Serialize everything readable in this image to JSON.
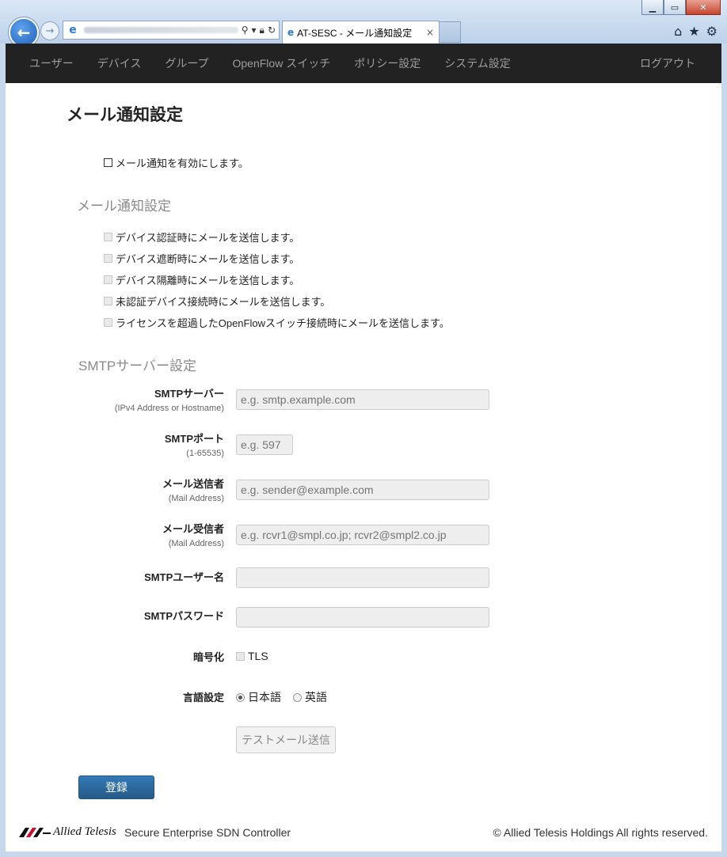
{
  "browser": {
    "tab_title": "AT-SESC - メール通知設定",
    "tab_close": "×",
    "window_buttons": [
      "minimize-icon",
      "maximize-icon",
      "close-icon"
    ],
    "toolbar_icons": [
      "home-icon",
      "star-icon",
      "gear-icon"
    ]
  },
  "nav": {
    "items": [
      "ユーザー",
      "デバイス",
      "グループ",
      "OpenFlow スイッチ",
      "ポリシー設定",
      "システム設定"
    ],
    "logout": "ログアウト"
  },
  "page": {
    "title": "メール通知設定",
    "enable_label": "メール通知を有効にします。"
  },
  "notify_section": {
    "title": "メール通知設定",
    "options": [
      "デバイス認証時にメールを送信します。",
      "デバイス遮断時にメールを送信します。",
      "デバイス隔離時にメールを送信します。",
      "未認証デバイス接続時にメールを送信します。",
      "ライセンスを超過したOpenFlowスイッチ接続時にメールを送信します。"
    ]
  },
  "smtp_section": {
    "title": "SMTPサーバー設定",
    "server": {
      "label": "SMTPサーバー",
      "sub": "(IPv4 Address or Hostname)",
      "placeholder": "e.g. smtp.example.com"
    },
    "port": {
      "label": "SMTPポート",
      "sub": "(1-65535)",
      "placeholder": "e.g. 597"
    },
    "sender": {
      "label": "メール送信者",
      "sub": "(Mail Address)",
      "placeholder": "e.g. sender@example.com"
    },
    "receiver": {
      "label": "メール受信者",
      "sub": "(Mail Address)",
      "placeholder": "e.g. rcvr1@smpl.co.jp; rcvr2@smpl2.co.jp"
    },
    "user": {
      "label": "SMTPユーザー名",
      "value": ""
    },
    "password": {
      "label": "SMTPパスワード",
      "value": ""
    },
    "encryption": {
      "label": "暗号化",
      "option": "TLS"
    },
    "language": {
      "label": "言語設定",
      "options": [
        "日本語",
        "英語"
      ],
      "selected": "日本語"
    },
    "test_button": "テストメール送信"
  },
  "submit_button": "登録",
  "footer": {
    "logo_text": "Allied Telesis",
    "product": "Secure Enterprise SDN Controller",
    "copyright": "© Allied Telesis Holdings All rights reserved."
  }
}
